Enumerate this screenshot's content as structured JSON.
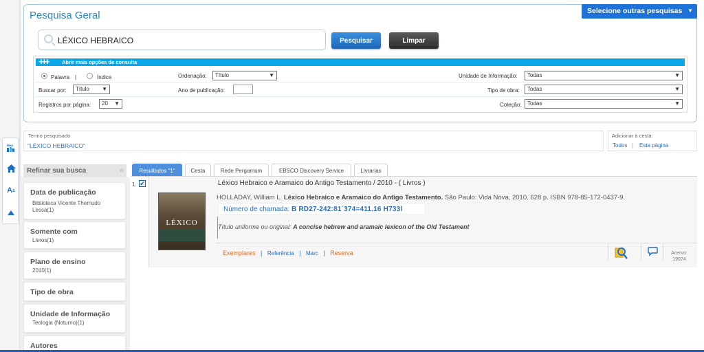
{
  "rail": {
    "icons": [
      "bookshelf-icon",
      "home-icon",
      "font-size-icon",
      "scroll-top-icon"
    ],
    "meu_label": "Meu"
  },
  "search": {
    "title": "Pesquisa Geral",
    "other_searches": "Selecione outras pesquisas",
    "query": "LÉXICO HEBRAICO",
    "search_btn": "Pesquisar",
    "clear_btn": "Limpar",
    "more_options": "Abrir mais opções de consulta",
    "radio_word": "Palavra",
    "radio_index": "Índice",
    "sep": "|",
    "search_by_label": "Buscar por:",
    "search_by_value": "Título",
    "per_page_label": "Registros por página:",
    "per_page_value": "20",
    "order_label": "Ordenação:",
    "order_value": "Título",
    "year_label": "Ano de publicação:",
    "year_value": "",
    "unit_label": "Unidade de Informação:",
    "unit_value": "Todas",
    "worktype_label": "Tipo de obra:",
    "worktype_value": "Todas",
    "collection_label": "Coleção:",
    "collection_value": "Todas"
  },
  "term": {
    "label": "Termo pesquisado",
    "value": "\"LÉXICO HEBRAICO\""
  },
  "cart": {
    "label": "Adicionar à cesta:",
    "all": "Todos",
    "sep": "|",
    "page": "Esta página"
  },
  "refine": {
    "title": "Refinar sua busca",
    "facets": [
      {
        "title": "Data de publicação",
        "values": [
          "Biblioteca Vicente Themudo",
          "Lessa(1)"
        ]
      },
      {
        "title": "Somente com",
        "values": [
          "Livros(1)"
        ]
      },
      {
        "title": "Plano de ensino",
        "values": [
          "2010(1)"
        ]
      },
      {
        "title": "Tipo de obra",
        "values": []
      },
      {
        "title": "Unidade de Informação",
        "values": [
          "Teologia (Noturno)(1)"
        ]
      },
      {
        "title": "Autores",
        "values": []
      }
    ]
  },
  "tabs": [
    "Resultados \"1\"",
    "Cesta",
    "Rede Pergamum",
    "EBSCO Discovery Service",
    "Livrarias"
  ],
  "result": {
    "number": "1.",
    "checked": "✔",
    "title": "Léxico Hebraico e Aramaico do Antigo Testamento / 2010 -  ( Livros )",
    "author": "HOLLADAY, William L.",
    "title_bold": "Léxico Hebraico e Aramaico do Antigo Testamento.",
    "imprint": "São Paulo: Vida Nova, 2010. 628 p. ISBN 978-85-172-0437-9.",
    "call_label": "Número de chamada:",
    "call_value": "B RD27-242:81´374=411.16 H733l",
    "uniform_label": "Título uniforme ou original:",
    "uniform_value": "A concise hebrew and aramaic lexicon of the Old Testament",
    "cover_text": "LÉXICO",
    "actions": {
      "exemplares": "Exemplares",
      "referencia": "Referência",
      "marc": "Marc",
      "reserva": "Reserva",
      "sep": "|"
    },
    "acervo_label": "Acervo:",
    "acervo_value": "19074"
  }
}
